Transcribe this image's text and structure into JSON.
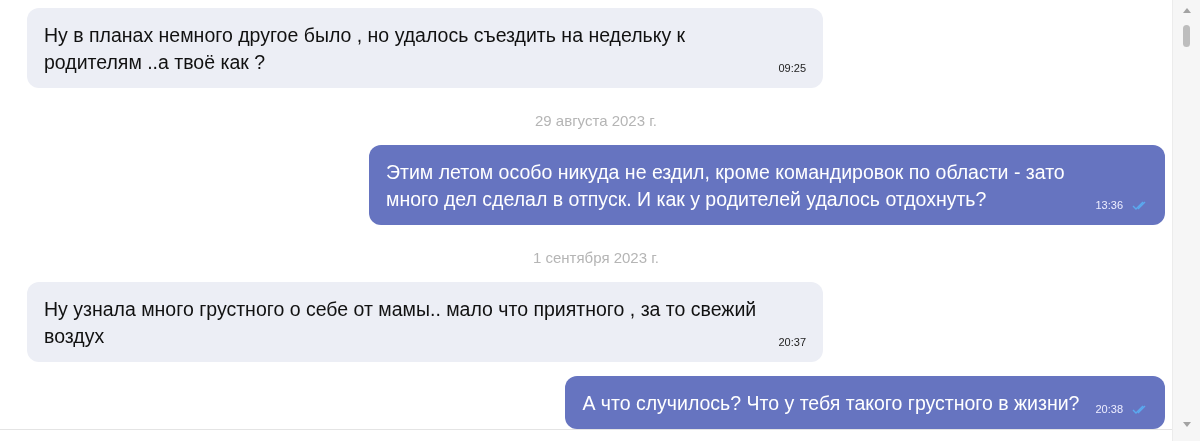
{
  "messages": [
    {
      "kind": "message",
      "outgoing": false,
      "text": "Ну в планах немного другое было , но удалось съездить на недельку к родителям ..а твоё как ?",
      "time": "09:25",
      "read": false
    },
    {
      "kind": "date",
      "text": "29 августа 2023 г."
    },
    {
      "kind": "message",
      "outgoing": true,
      "text": "Этим летом особо никуда не ездил, кроме командировок по области - зато много дел сделал в отпуск. И как у родителей удалось отдохнуть?",
      "time": "13:36",
      "read": true
    },
    {
      "kind": "date",
      "text": "1 сентября 2023 г."
    },
    {
      "kind": "message",
      "outgoing": false,
      "text": "Ну узнала много грустного о себе от мамы.. мало что приятного , за то свежий воздух",
      "time": "20:37",
      "read": false
    },
    {
      "kind": "message",
      "outgoing": true,
      "text": "А что случилось? Что у тебя такого грустного в жизни?",
      "time": "20:38",
      "read": true
    }
  ]
}
